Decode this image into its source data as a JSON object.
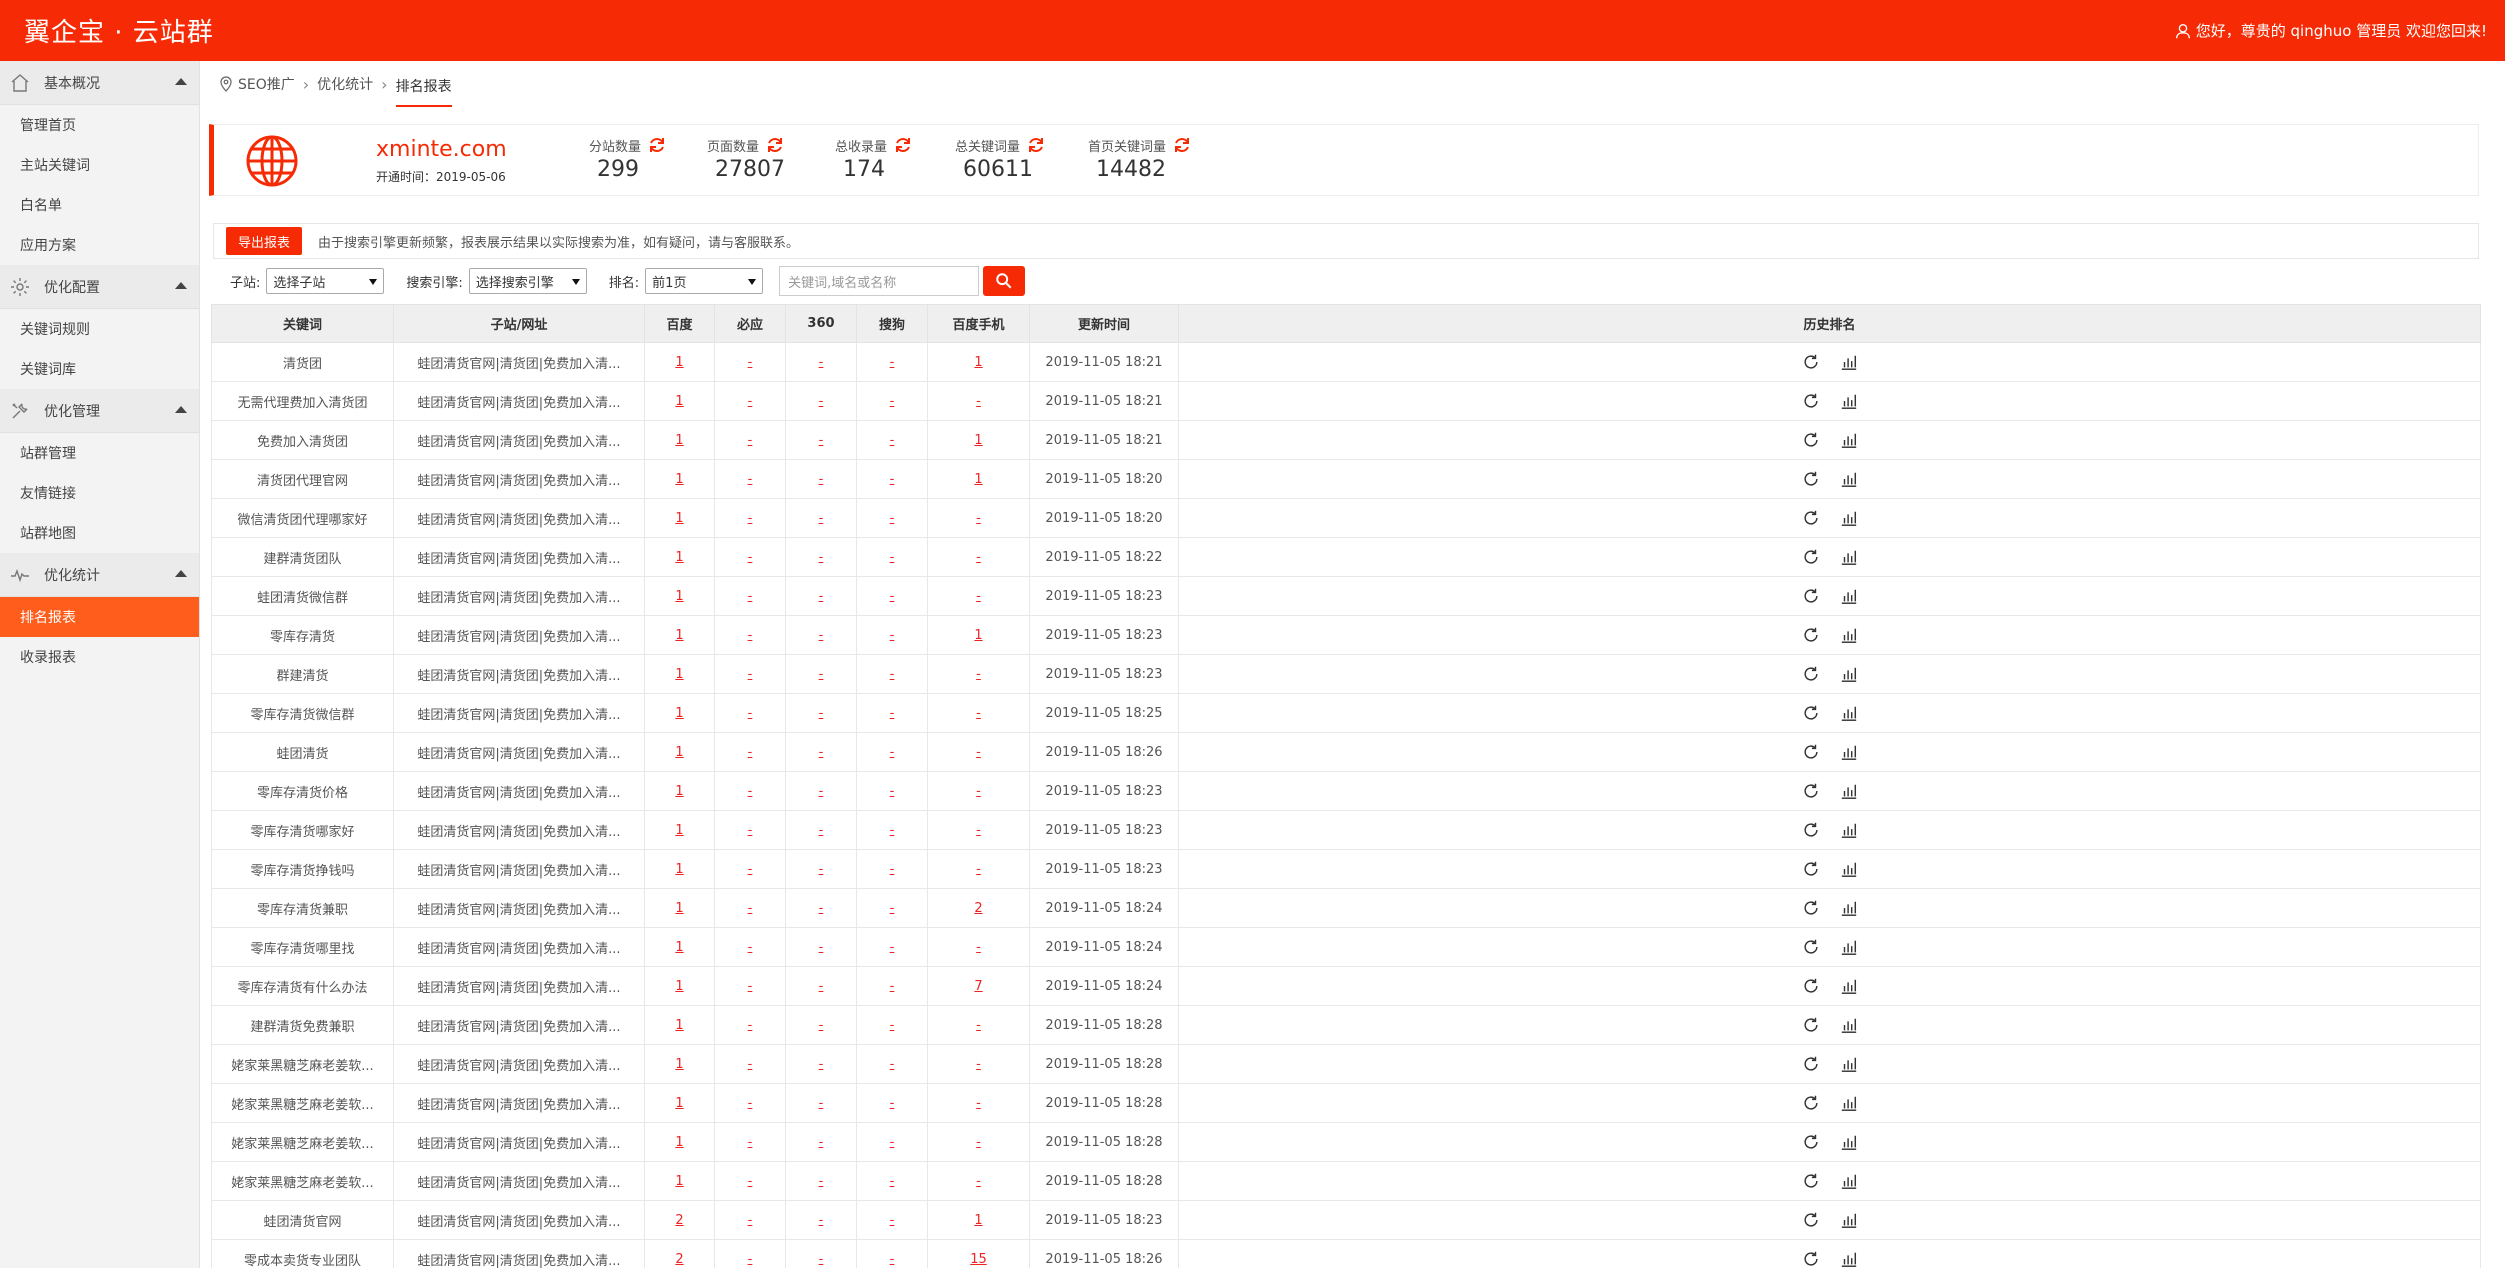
{
  "header": {
    "brand": "翼企宝 · 云站群",
    "greeting": "您好，尊贵的 qinghuo 管理员 欢迎您回来!"
  },
  "sidebar": {
    "groups": [
      {
        "label": "基本概况",
        "icon": "home-icon",
        "items": [
          "管理首页",
          "主站关键词",
          "白名单",
          "应用方案"
        ]
      },
      {
        "label": "优化配置",
        "icon": "gear-icon",
        "items": [
          "关键词规则",
          "关键词库"
        ]
      },
      {
        "label": "优化管理",
        "icon": "tools-icon",
        "items": [
          "站群管理",
          "友情链接",
          "站群地图"
        ]
      },
      {
        "label": "优化统计",
        "icon": "pulse-icon",
        "items": [
          "排名报表",
          "收录报表"
        ]
      }
    ],
    "active_item": "排名报表"
  },
  "breadcrumb": [
    "SEO推广",
    "优化统计",
    "排名报表"
  ],
  "site": {
    "domain": "xminte.com",
    "open_time": "开通时间：2019-05-06",
    "stats": [
      {
        "label": "分站数量",
        "value": "299"
      },
      {
        "label": "页面数量",
        "value": "27807"
      },
      {
        "label": "总收录量",
        "value": "174"
      },
      {
        "label": "总关键词量",
        "value": "60611"
      },
      {
        "label": "首页关键词量",
        "value": "14482"
      }
    ]
  },
  "notice": {
    "export_label": "导出报表",
    "message": "由于搜索引擎更新频繁，报表展示结果以实际搜索为准，如有疑问，请与客服联系。"
  },
  "filters": {
    "site_label": "子站:",
    "site_value": "选择子站",
    "engine_label": "搜索引擎:",
    "engine_value": "选择搜索引擎",
    "rank_label": "排名:",
    "rank_value": "前1页",
    "search_placeholder": "关键词,域名或名称"
  },
  "table": {
    "columns": [
      "关键词",
      "子站/网址",
      "百度",
      "必应",
      "360",
      "搜狗",
      "百度手机",
      "更新时间",
      "历史排名"
    ],
    "url_text": "蛙团清货官网|清货团|免费加入清...",
    "rows": [
      {
        "kw": "清货团",
        "baidu": "1",
        "bing": "-",
        "s360": "-",
        "sogou": "-",
        "mobile": "1",
        "time": "2019-11-05 18:21"
      },
      {
        "kw": "无需代理费加入清货团",
        "baidu": "1",
        "bing": "-",
        "s360": "-",
        "sogou": "-",
        "mobile": "-",
        "time": "2019-11-05 18:21"
      },
      {
        "kw": "免费加入清货团",
        "baidu": "1",
        "bing": "-",
        "s360": "-",
        "sogou": "-",
        "mobile": "1",
        "time": "2019-11-05 18:21"
      },
      {
        "kw": "清货团代理官网",
        "baidu": "1",
        "bing": "-",
        "s360": "-",
        "sogou": "-",
        "mobile": "1",
        "time": "2019-11-05 18:20"
      },
      {
        "kw": "微信清货团代理哪家好",
        "baidu": "1",
        "bing": "-",
        "s360": "-",
        "sogou": "-",
        "mobile": "-",
        "time": "2019-11-05 18:20"
      },
      {
        "kw": "建群清货团队",
        "baidu": "1",
        "bing": "-",
        "s360": "-",
        "sogou": "-",
        "mobile": "-",
        "time": "2019-11-05 18:22"
      },
      {
        "kw": "蛙团清货微信群",
        "baidu": "1",
        "bing": "-",
        "s360": "-",
        "sogou": "-",
        "mobile": "-",
        "time": "2019-11-05 18:23"
      },
      {
        "kw": "零库存清货",
        "baidu": "1",
        "bing": "-",
        "s360": "-",
        "sogou": "-",
        "mobile": "1",
        "time": "2019-11-05 18:23"
      },
      {
        "kw": "群建清货",
        "baidu": "1",
        "bing": "-",
        "s360": "-",
        "sogou": "-",
        "mobile": "-",
        "time": "2019-11-05 18:23"
      },
      {
        "kw": "零库存清货微信群",
        "baidu": "1",
        "bing": "-",
        "s360": "-",
        "sogou": "-",
        "mobile": "-",
        "time": "2019-11-05 18:25"
      },
      {
        "kw": "蛙团清货",
        "baidu": "1",
        "bing": "-",
        "s360": "-",
        "sogou": "-",
        "mobile": "-",
        "time": "2019-11-05 18:26"
      },
      {
        "kw": "零库存清货价格",
        "baidu": "1",
        "bing": "-",
        "s360": "-",
        "sogou": "-",
        "mobile": "-",
        "time": "2019-11-05 18:23"
      },
      {
        "kw": "零库存清货哪家好",
        "baidu": "1",
        "bing": "-",
        "s360": "-",
        "sogou": "-",
        "mobile": "-",
        "time": "2019-11-05 18:23"
      },
      {
        "kw": "零库存清货挣钱吗",
        "baidu": "1",
        "bing": "-",
        "s360": "-",
        "sogou": "-",
        "mobile": "-",
        "time": "2019-11-05 18:23"
      },
      {
        "kw": "零库存清货兼职",
        "baidu": "1",
        "bing": "-",
        "s360": "-",
        "sogou": "-",
        "mobile": "2",
        "time": "2019-11-05 18:24"
      },
      {
        "kw": "零库存清货哪里找",
        "baidu": "1",
        "bing": "-",
        "s360": "-",
        "sogou": "-",
        "mobile": "-",
        "time": "2019-11-05 18:24"
      },
      {
        "kw": "零库存清货有什么办法",
        "baidu": "1",
        "bing": "-",
        "s360": "-",
        "sogou": "-",
        "mobile": "7",
        "time": "2019-11-05 18:24"
      },
      {
        "kw": "建群清货免费兼职",
        "baidu": "1",
        "bing": "-",
        "s360": "-",
        "sogou": "-",
        "mobile": "-",
        "time": "2019-11-05 18:28"
      },
      {
        "kw": "姥家莱黑糖芝麻老姜软...",
        "baidu": "1",
        "bing": "-",
        "s360": "-",
        "sogou": "-",
        "mobile": "-",
        "time": "2019-11-05 18:28"
      },
      {
        "kw": "姥家莱黑糖芝麻老姜软...",
        "baidu": "1",
        "bing": "-",
        "s360": "-",
        "sogou": "-",
        "mobile": "-",
        "time": "2019-11-05 18:28"
      },
      {
        "kw": "姥家莱黑糖芝麻老姜软...",
        "baidu": "1",
        "bing": "-",
        "s360": "-",
        "sogou": "-",
        "mobile": "-",
        "time": "2019-11-05 18:28"
      },
      {
        "kw": "姥家莱黑糖芝麻老姜软...",
        "baidu": "1",
        "bing": "-",
        "s360": "-",
        "sogou": "-",
        "mobile": "-",
        "time": "2019-11-05 18:28"
      },
      {
        "kw": "蛙团清货官网",
        "baidu": "2",
        "bing": "-",
        "s360": "-",
        "sogou": "-",
        "mobile": "1",
        "time": "2019-11-05 18:23"
      },
      {
        "kw": "零成本卖货专业团队",
        "baidu": "2",
        "bing": "-",
        "s360": "-",
        "sogou": "-",
        "mobile": "15",
        "time": "2019-11-05 18:26"
      }
    ]
  },
  "colors": {
    "accent": "#f62b05",
    "active_item": "#ff5d1b"
  }
}
